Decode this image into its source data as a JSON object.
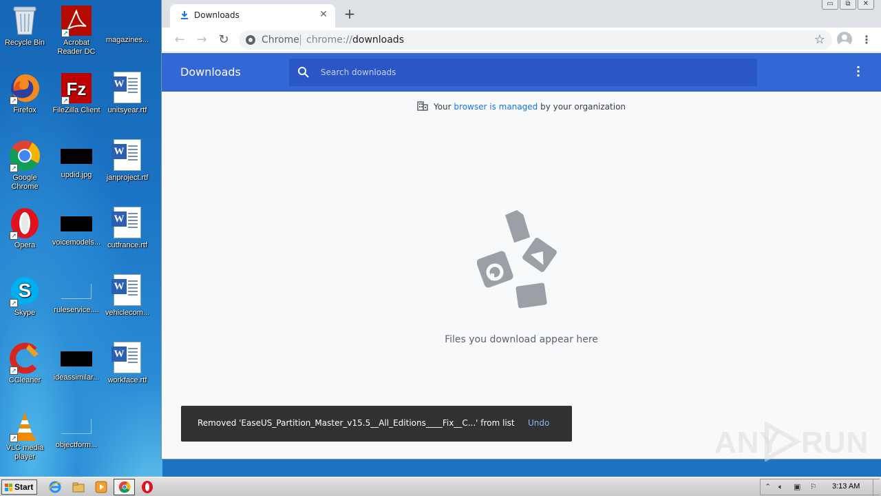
{
  "desktop": {
    "icons": [
      {
        "label": "Recycle Bin"
      },
      {
        "label": "Acrobat Reader DC"
      },
      {
        "label": "magazines..."
      },
      {
        "label": "Firefox"
      },
      {
        "label": "FileZilla Client"
      },
      {
        "label": "unitsyear.rtf"
      },
      {
        "label": "Google Chrome"
      },
      {
        "label": "updid.jpg"
      },
      {
        "label": "janproject.rtf"
      },
      {
        "label": "Opera"
      },
      {
        "label": "voicemodels..."
      },
      {
        "label": "cutfrance.rtf"
      },
      {
        "label": "Skype"
      },
      {
        "label": "ruleservice...."
      },
      {
        "label": "vehiclecom..."
      },
      {
        "label": "CCleaner"
      },
      {
        "label": "ideassimilar..."
      },
      {
        "label": "workface.rtf"
      },
      {
        "label": "VLC media player"
      },
      {
        "label": "objectform..."
      }
    ]
  },
  "browser": {
    "tab_title": "Downloads",
    "omnibox": {
      "chip": "Chrome",
      "scheme": "chrome://",
      "host": "downloads"
    },
    "window_controls": {
      "minimize": "▭",
      "restore": "⧉",
      "close": "✕"
    }
  },
  "downloads": {
    "title": "Downloads",
    "search_placeholder": "Search downloads",
    "managed": {
      "prefix": "Your ",
      "link": "browser is managed",
      "suffix": " by your organization"
    },
    "empty_text": "Files you download appear here",
    "toast": {
      "message": "Removed 'EaseUS_Partition_Master_v15.5__All_Editions____Fix__C...' from list",
      "undo_label": "Undo"
    }
  },
  "taskbar": {
    "start_label": "Start",
    "clock": "3:13 AM"
  },
  "watermark": {
    "left": "ANY",
    "right": "RUN"
  },
  "colors": {
    "header_blue": "#3367d6",
    "search_blue": "#2a56c6",
    "toast_bg": "#323232",
    "link_blue": "#1a73e8",
    "undo_blue": "#8ab4f8"
  }
}
